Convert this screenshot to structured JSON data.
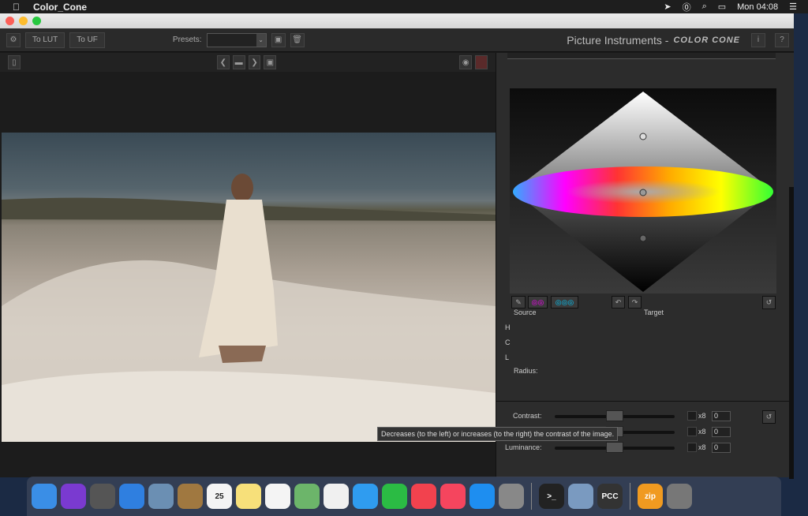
{
  "menubar": {
    "app": "Color_Cone",
    "clock": "Mon 04:08",
    "icons": [
      "apple-icon",
      "location-icon",
      "onepassword-icon",
      "search-icon",
      "airplay-icon",
      "list-icon"
    ]
  },
  "toolbar": {
    "to_lut": "To LUT",
    "to_uf": "To UF",
    "presets_label": "Presets:",
    "presets_value": "",
    "brand": "Picture Instruments -",
    "product": "COLOR CONE",
    "info": "i",
    "help": "?"
  },
  "panel": {
    "source": "Source",
    "target": "Target",
    "h": "H",
    "c": "C",
    "l": "L",
    "radius": "Radius:",
    "sliders": [
      {
        "label": "Contrast:",
        "mult": "x8",
        "value": "0",
        "level": 0.5
      },
      {
        "label": "",
        "mult": "x8",
        "value": "0",
        "level": 0.5
      },
      {
        "label": "Luminance:",
        "mult": "x8",
        "value": "0",
        "level": 0.5
      }
    ]
  },
  "tooltip": "Decreases (to the left) or increases (to the right) the contrast of the image.",
  "dock": {
    "apps": [
      {
        "name": "finder",
        "c": "#3a8ee6"
      },
      {
        "name": "siri",
        "c": "#7a3ad0"
      },
      {
        "name": "launchpad",
        "c": "#555"
      },
      {
        "name": "safari",
        "c": "#2f7fe0"
      },
      {
        "name": "mail",
        "c": "#6b8fb3"
      },
      {
        "name": "contacts",
        "c": "#a07840"
      },
      {
        "name": "calendar",
        "c": "#f4f4f4",
        "t": "25"
      },
      {
        "name": "notes",
        "c": "#f7e07a"
      },
      {
        "name": "reminders",
        "c": "#f4f4f4"
      },
      {
        "name": "maps",
        "c": "#6cb56a"
      },
      {
        "name": "photos",
        "c": "#f0f0f0"
      },
      {
        "name": "messages",
        "c": "#2f9cf0"
      },
      {
        "name": "facetime",
        "c": "#2bbb44"
      },
      {
        "name": "news",
        "c": "#f2424e"
      },
      {
        "name": "music",
        "c": "#f5455e"
      },
      {
        "name": "app-store",
        "c": "#1e8ef0"
      },
      {
        "name": "system-preferences",
        "c": "#888"
      }
    ],
    "recent": [
      {
        "name": "terminal",
        "c": "#222",
        "t": ">_"
      },
      {
        "name": "preview",
        "c": "#7a9ac0"
      },
      {
        "name": "color-cone",
        "c": "#333",
        "t": "PCC"
      }
    ],
    "extra": [
      {
        "name": "zip-archive",
        "c": "#f09a20",
        "t": "zip"
      },
      {
        "name": "trash",
        "c": "#777"
      }
    ]
  }
}
